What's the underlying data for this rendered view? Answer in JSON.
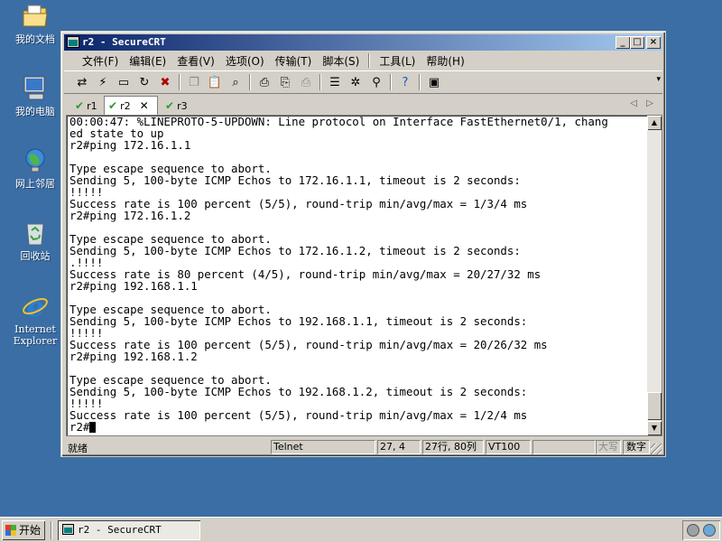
{
  "desktop": {
    "icons": [
      {
        "name": "my-documents",
        "label": "我的文档"
      },
      {
        "name": "my-computer",
        "label": "我的电脑"
      },
      {
        "name": "network-places",
        "label": "网上邻居"
      },
      {
        "name": "recycle-bin",
        "label": "回收站"
      },
      {
        "name": "internet-explorer",
        "label": "Internet Explorer"
      }
    ]
  },
  "window": {
    "title": "r2 - SecureCRT",
    "buttons": {
      "minimize": "_",
      "maximize": "□",
      "close": "×"
    }
  },
  "menubar": {
    "items": [
      "文件(F)",
      "编辑(E)",
      "查看(V)",
      "选项(O)",
      "传输(T)",
      "脚本(S)",
      "工具(L)",
      "帮助(H)"
    ]
  },
  "toolbar": {
    "icons": [
      "connect-icon",
      "quick-connect-icon",
      "connect-in-tab-icon",
      "reconnect-icon",
      "disconnect-icon",
      "copy-icon",
      "paste-icon",
      "find-icon",
      "print-icon",
      "print-selection-icon",
      "print-setup-icon",
      "session-options-icon",
      "global-options-icon",
      "keymap-icon",
      "help-icon",
      "about-icon"
    ]
  },
  "tabs": [
    {
      "label": "r1",
      "active": false
    },
    {
      "label": "r2",
      "active": true
    },
    {
      "label": "r3",
      "active": false
    }
  ],
  "terminal": {
    "lines": [
      "00:00:47: %LINEPROTO-5-UPDOWN: Line protocol on Interface FastEthernet0/1, chang",
      "ed state to up",
      "r2#ping 172.16.1.1",
      "",
      "Type escape sequence to abort.",
      "Sending 5, 100-byte ICMP Echos to 172.16.1.1, timeout is 2 seconds:",
      "!!!!!",
      "Success rate is 100 percent (5/5), round-trip min/avg/max = 1/3/4 ms",
      "r2#ping 172.16.1.2",
      "",
      "Type escape sequence to abort.",
      "Sending 5, 100-byte ICMP Echos to 172.16.1.2, timeout is 2 seconds:",
      ".!!!!",
      "Success rate is 80 percent (4/5), round-trip min/avg/max = 20/27/32 ms",
      "r2#ping 192.168.1.1",
      "",
      "Type escape sequence to abort.",
      "Sending 5, 100-byte ICMP Echos to 192.168.1.1, timeout is 2 seconds:",
      "!!!!!",
      "Success rate is 100 percent (5/5), round-trip min/avg/max = 20/26/32 ms",
      "r2#ping 192.168.1.2",
      "",
      "Type escape sequence to abort.",
      "Sending 5, 100-byte ICMP Echos to 192.168.1.2, timeout is 2 seconds:",
      "!!!!!",
      "Success rate is 100 percent (5/5), round-trip min/avg/max = 1/2/4 ms"
    ],
    "prompt": "r2#"
  },
  "statusbar": {
    "ready": "就绪",
    "protocol": "Telnet",
    "cursor_pos": "27,  4",
    "size": "27行, 80列",
    "emulation": "VT100",
    "caps": "大写",
    "num": "数字"
  },
  "taskbar": {
    "start": "开始",
    "task": "r2 - SecureCRT"
  }
}
